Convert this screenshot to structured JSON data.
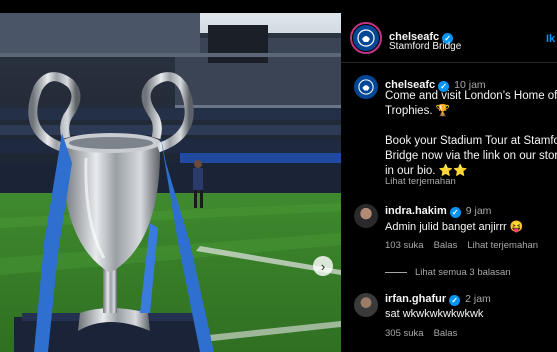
{
  "post": {
    "username": "chelseafc",
    "location": "Stamford Bridge",
    "follow_label": "Ik",
    "caption_time": "10 jam",
    "caption_lines": [
      "Come and visit London’s Home of",
      "Trophies. 🏆",
      "",
      "Book your Stadium Tour at Stamford",
      "Bridge now via the link on our story",
      "in our bio. ⭐⭐"
    ],
    "translate_label": "Lihat terjemahan"
  },
  "comments": [
    {
      "username": "indra.hakim",
      "time": "9 jam",
      "text": "Admin julid banget anjirrr 😝",
      "likes": "103 suka",
      "reply_label": "Balas",
      "translate_label": "Lihat terjemahan",
      "view_replies": "Lihat semua 3 balasan"
    },
    {
      "username": "irfan.ghafur",
      "time": "2 jam",
      "text": "sat wkwkwkwkwkwk",
      "likes": "305 suka",
      "reply_label": "Balas"
    }
  ],
  "icons": {
    "verified": "verified-badge-icon",
    "next": "chevron-right-icon",
    "heart": "heart-icon"
  },
  "colors": {
    "background": "#000000",
    "link_blue": "#0095f6",
    "muted_text": "#a8a8a8",
    "chelsea_blue": "#034694"
  }
}
